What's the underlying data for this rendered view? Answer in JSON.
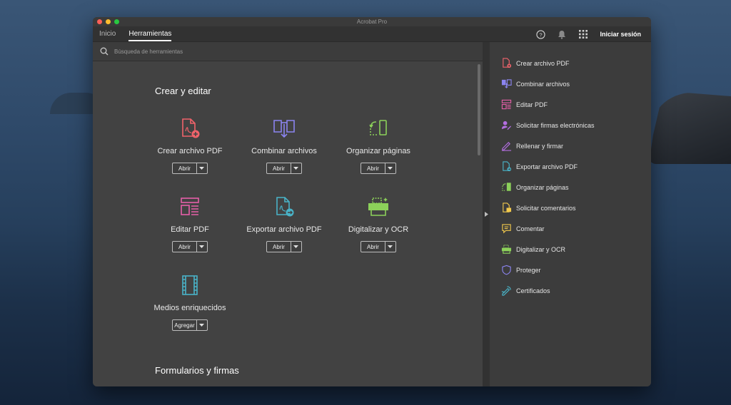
{
  "window": {
    "title": "Acrobat Pro"
  },
  "tabs": [
    {
      "label": "Inicio",
      "active": false
    },
    {
      "label": "Herramientas",
      "active": true
    }
  ],
  "header": {
    "help_icon": "help-icon",
    "bell_icon": "bell-icon",
    "apps_icon": "apps-grid-icon",
    "signin_label": "Iniciar sesión"
  },
  "search": {
    "placeholder": "Búsqueda de herramientas"
  },
  "sections": {
    "create_edit": "Crear y editar",
    "forms": "Formularios y firmas"
  },
  "tools": [
    {
      "label": "Crear archivo PDF",
      "button": "Abrir",
      "icon": "create-pdf-icon",
      "color": "#f0636b"
    },
    {
      "label": "Combinar archivos",
      "button": "Abrir",
      "icon": "combine-files-icon",
      "color": "#8b84f0"
    },
    {
      "label": "Organizar páginas",
      "button": "Abrir",
      "icon": "organize-pages-icon",
      "color": "#8cd15a"
    },
    {
      "label": "Editar PDF",
      "button": "Abrir",
      "icon": "edit-pdf-icon",
      "color": "#e65fa8"
    },
    {
      "label": "Exportar archivo PDF",
      "button": "Abrir",
      "icon": "export-pdf-icon",
      "color": "#49b3c8"
    },
    {
      "label": "Digitalizar y OCR",
      "button": "Abrir",
      "icon": "scan-ocr-icon",
      "color": "#8cd15a"
    },
    {
      "label": "Medios enriquecidos",
      "button": "Agregar",
      "icon": "rich-media-icon",
      "color": "#49b3c8"
    }
  ],
  "sidebar": {
    "items": [
      {
        "label": "Crear archivo PDF",
        "icon": "create-pdf-icon",
        "color": "#f0636b"
      },
      {
        "label": "Combinar archivos",
        "icon": "combine-files-icon",
        "color": "#8b84f0"
      },
      {
        "label": "Editar PDF",
        "icon": "edit-pdf-icon",
        "color": "#e65fa8"
      },
      {
        "label": "Solicitar firmas electrónicas",
        "icon": "request-signatures-icon",
        "color": "#b36ee0"
      },
      {
        "label": "Rellenar y firmar",
        "icon": "fill-sign-icon",
        "color": "#b36ee0"
      },
      {
        "label": "Exportar archivo PDF",
        "icon": "export-pdf-icon",
        "color": "#49b3c8"
      },
      {
        "label": "Organizar páginas",
        "icon": "organize-pages-icon",
        "color": "#8cd15a"
      },
      {
        "label": "Solicitar comentarios",
        "icon": "request-comments-icon",
        "color": "#f2c94c"
      },
      {
        "label": "Comentar",
        "icon": "comment-icon",
        "color": "#f2c94c"
      },
      {
        "label": "Digitalizar y OCR",
        "icon": "scan-ocr-icon",
        "color": "#8cd15a"
      },
      {
        "label": "Proteger",
        "icon": "shield-icon",
        "color": "#8b84f0"
      },
      {
        "label": "Certificados",
        "icon": "certificates-icon",
        "color": "#49b3c8"
      }
    ]
  }
}
